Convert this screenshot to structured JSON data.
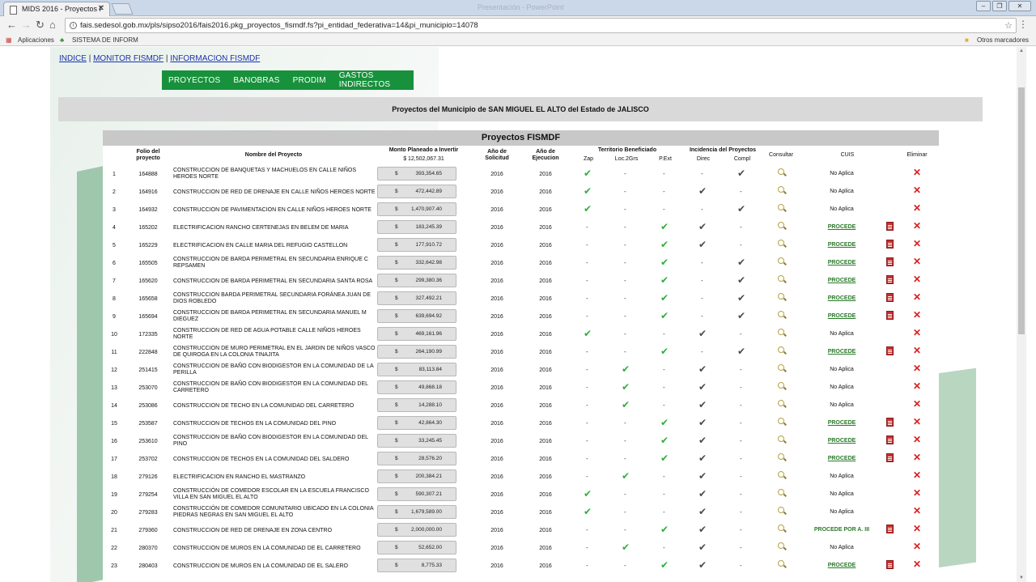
{
  "browser": {
    "tab_title": "MIDS 2016 - Proyectos F",
    "window_title": "Presentación - PowerPoint",
    "url": "fais.sedesol.gob.mx/pls/sipso2016/fais2016.pkg_proyectos_fismdf.fs?pi_entidad_federativa=14&pi_municipio=14078",
    "bookmarks": [
      "Aplicaciones",
      "SISTEMA DE INFORM"
    ],
    "other_bookmarks": "Otros marcadores"
  },
  "page": {
    "links": [
      "INDICE",
      "MONITOR FISMDF",
      "INFORMACION FISMDF"
    ],
    "separator": "|",
    "nav": [
      "PROYECTOS",
      "BANOBRAS",
      "PRODIM",
      "GASTOS INDIRECTOS"
    ],
    "header": "Proyectos del Municipio de SAN MIGUEL EL ALTO del Estado de JALISCO",
    "table_title": "Proyectos FISMDF",
    "columns": {
      "folio": "Folio del proyecto",
      "nombre": "Nombre del Proyecto",
      "monto": "Monto Planeado a Invertir",
      "monto_total": "$ 12,502,067.31",
      "anio_sol": "Año de Solicitud",
      "anio_eje": "Año de Ejecucion",
      "territorio": "Territorio Beneficiado",
      "zap": "Zap",
      "loc": "Loc.2Grs",
      "pext": "P.Ext",
      "incidencia": "Incidencia del Proyectos",
      "direc": "Direc",
      "compl": "Compl",
      "consultar": "Consultar",
      "cuis": "CUIS",
      "eliminar": "Eliminar"
    },
    "currency": "$",
    "dash": "-",
    "rows": [
      {
        "n": "1",
        "folio": "164888",
        "nombre": "CONSTRUCCION DE BANQUETAS Y MACHUELOS EN CALLE NIÑOS HEROES NORTE",
        "monto": "393,354.65",
        "sol": "2016",
        "eje": "2016",
        "zap": 1,
        "loc": 0,
        "pext": 0,
        "direc": 0,
        "compl": 1,
        "cuis": "No Aplica",
        "pdf": 0
      },
      {
        "n": "2",
        "folio": "164916",
        "nombre": "CONSTRUCCION DE RED DE DRENAJE EN CALLE NIÑOS HEROES NORTE",
        "monto": "472,442.89",
        "sol": "2016",
        "eje": "2016",
        "zap": 1,
        "loc": 0,
        "pext": 0,
        "direc": 1,
        "compl": 0,
        "cuis": "No Aplica",
        "pdf": 0
      },
      {
        "n": "3",
        "folio": "164932",
        "nombre": "CONSTRUCCION DE PAVIMENTACION EN CALLE NIÑOS HEROES NORTE",
        "monto": "1,470,907.40",
        "sol": "2016",
        "eje": "2016",
        "zap": 1,
        "loc": 0,
        "pext": 0,
        "direc": 0,
        "compl": 1,
        "cuis": "No Aplica",
        "pdf": 0
      },
      {
        "n": "4",
        "folio": "165202",
        "nombre": "ELECTRIFICACION RANCHO CERTENEJAS EN BELEM DE MARIA",
        "monto": "183,245.39",
        "sol": "2016",
        "eje": "2016",
        "zap": 0,
        "loc": 0,
        "pext": 1,
        "direc": 1,
        "compl": 0,
        "cuis": "PROCEDE",
        "pdf": 1
      },
      {
        "n": "5",
        "folio": "165229",
        "nombre": "ELECTRIFICACION EN CALLE MARIA DEL REFUGIO CASTELLON",
        "monto": "177,910.72",
        "sol": "2016",
        "eje": "2016",
        "zap": 0,
        "loc": 0,
        "pext": 1,
        "direc": 1,
        "compl": 0,
        "cuis": "PROCEDE",
        "pdf": 1
      },
      {
        "n": "6",
        "folio": "165505",
        "nombre": "CONSTRUCCION DE BARDA PERIMETRAL EN SECUNDARIA ENRIQUE C REPSAMEN",
        "monto": "332,642.98",
        "sol": "2016",
        "eje": "2016",
        "zap": 0,
        "loc": 0,
        "pext": 1,
        "direc": 0,
        "compl": 1,
        "cuis": "PROCEDE",
        "pdf": 1
      },
      {
        "n": "7",
        "folio": "165620",
        "nombre": "CONSTRUCCION DE BARDA PERIMETRAL EN SECUNDARIA SANTA ROSA",
        "monto": "299,380.36",
        "sol": "2016",
        "eje": "2016",
        "zap": 0,
        "loc": 0,
        "pext": 1,
        "direc": 0,
        "compl": 1,
        "cuis": "PROCEDE",
        "pdf": 1
      },
      {
        "n": "8",
        "folio": "165658",
        "nombre": "CONSTRUCCION BARDA PERIMETRAL SECUNDARIA FORÁNEA JUAN DE DIOS ROBLEDO",
        "monto": "327,492.21",
        "sol": "2016",
        "eje": "2016",
        "zap": 0,
        "loc": 0,
        "pext": 1,
        "direc": 0,
        "compl": 1,
        "cuis": "PROCEDE",
        "pdf": 1
      },
      {
        "n": "9",
        "folio": "165694",
        "nombre": "CONSTRUCCION DE BARDA PERIMETRAL EN SECUNDARIA MANUEL M DIEGUEZ",
        "monto": "639,694.92",
        "sol": "2016",
        "eje": "2016",
        "zap": 0,
        "loc": 0,
        "pext": 1,
        "direc": 0,
        "compl": 1,
        "cuis": "PROCEDE",
        "pdf": 1
      },
      {
        "n": "10",
        "folio": "172335",
        "nombre": "CONSTRUCCION DE RED DE AGUA POTABLE CALLE NIÑOS HEROES NORTE",
        "monto": "469,161.96",
        "sol": "2016",
        "eje": "2016",
        "zap": 1,
        "loc": 0,
        "pext": 0,
        "direc": 1,
        "compl": 0,
        "cuis": "No Aplica",
        "pdf": 0
      },
      {
        "n": "11",
        "folio": "222848",
        "nombre": "CONSTRUCCION DE MURO PERIMETRAL EN EL JARDIN DE NIÑOS VASCO DE QUIROGA EN LA COLONIA TINAJITA",
        "monto": "264,190.99",
        "sol": "2016",
        "eje": "2016",
        "zap": 0,
        "loc": 0,
        "pext": 1,
        "direc": 0,
        "compl": 1,
        "cuis": "PROCEDE",
        "pdf": 1
      },
      {
        "n": "12",
        "folio": "251415",
        "nombre": "CONSTRUCCION DE BAÑO CON BIODIGESTOR EN LA COMUNIDAD DE LA PERILLA",
        "monto": "83,113.84",
        "sol": "2016",
        "eje": "2016",
        "zap": 0,
        "loc": 1,
        "pext": 0,
        "direc": 1,
        "compl": 0,
        "cuis": "No Aplica",
        "pdf": 0
      },
      {
        "n": "13",
        "folio": "253070",
        "nombre": "CONSTRUCCION DE BAÑO CON BIODIGESTOR EN LA COMUNIDAD DEL CARRETERO",
        "monto": "49,868.18",
        "sol": "2016",
        "eje": "2016",
        "zap": 0,
        "loc": 1,
        "pext": 0,
        "direc": 1,
        "compl": 0,
        "cuis": "No Aplica",
        "pdf": 0
      },
      {
        "n": "14",
        "folio": "253086",
        "nombre": "CONSTRUCCION DE TECHO EN LA COMUNIDAD DEL CARRETERO",
        "monto": "14,288.10",
        "sol": "2016",
        "eje": "2016",
        "zap": 0,
        "loc": 1,
        "pext": 0,
        "direc": 1,
        "compl": 0,
        "cuis": "No Aplica",
        "pdf": 0
      },
      {
        "n": "15",
        "folio": "253587",
        "nombre": "CONSTRUCCION DE TECHOS EN LA COMUNIDAD DEL PINO",
        "monto": "42,864.30",
        "sol": "2016",
        "eje": "2016",
        "zap": 0,
        "loc": 0,
        "pext": 1,
        "direc": 1,
        "compl": 0,
        "cuis": "PROCEDE",
        "pdf": 1
      },
      {
        "n": "16",
        "folio": "253610",
        "nombre": "CONSTRUCCION DE BAÑO CON BIODIGESTOR EN LA COMUNIDAD DEL PINO",
        "monto": "33,245.45",
        "sol": "2016",
        "eje": "2016",
        "zap": 0,
        "loc": 0,
        "pext": 1,
        "direc": 1,
        "compl": 0,
        "cuis": "PROCEDE",
        "pdf": 1
      },
      {
        "n": "17",
        "folio": "253702",
        "nombre": "CONSTRUCCION DE TECHOS EN LA COMUNIDAD DEL SALDERO",
        "monto": "28,576.20",
        "sol": "2016",
        "eje": "2016",
        "zap": 0,
        "loc": 0,
        "pext": 1,
        "direc": 1,
        "compl": 0,
        "cuis": "PROCEDE",
        "pdf": 1
      },
      {
        "n": "18",
        "folio": "279126",
        "nombre": "ELECTRIFICACION EN RANCHO EL MASTRANZO",
        "monto": "200,384.21",
        "sol": "2016",
        "eje": "2016",
        "zap": 0,
        "loc": 1,
        "pext": 0,
        "direc": 1,
        "compl": 0,
        "cuis": "No Aplica",
        "pdf": 0
      },
      {
        "n": "19",
        "folio": "279254",
        "nombre": "CONSTRUCCIÓN DE COMEDOR ESCOLAR EN LA ESCUELA FRANCISCO VILLA EN SAN MIGUEL EL ALTO",
        "monto": "590,307.21",
        "sol": "2016",
        "eje": "2016",
        "zap": 1,
        "loc": 0,
        "pext": 0,
        "direc": 1,
        "compl": 0,
        "cuis": "No Aplica",
        "pdf": 0
      },
      {
        "n": "20",
        "folio": "279283",
        "nombre": "CONSTRUCCIÓN DE COMEDOR COMUNITARIO UBICADO EN LA COLONIA PIEDRAS NEGRAS EN SAN MIGUEL EL ALTO",
        "monto": "1,679,589.00",
        "sol": "2016",
        "eje": "2016",
        "zap": 1,
        "loc": 0,
        "pext": 0,
        "direc": 1,
        "compl": 0,
        "cuis": "No Aplica",
        "pdf": 0
      },
      {
        "n": "21",
        "folio": "279360",
        "nombre": "CONSTRUCCION DE RED DE DRENAJE EN ZONA CENTRO",
        "monto": "2,000,000.00",
        "sol": "2016",
        "eje": "2016",
        "zap": 0,
        "loc": 0,
        "pext": 1,
        "direc": 1,
        "compl": 0,
        "cuis": "PROCEDE POR A. III",
        "pdf": 1
      },
      {
        "n": "22",
        "folio": "280370",
        "nombre": "CONSTRUCCION DE MUROS EN LA COMUNIDAD DE EL CARRETERO",
        "monto": "52,652.00",
        "sol": "2016",
        "eje": "2016",
        "zap": 0,
        "loc": 1,
        "pext": 0,
        "direc": 1,
        "compl": 0,
        "cuis": "No Aplica",
        "pdf": 0
      },
      {
        "n": "23",
        "folio": "280403",
        "nombre": "CONSTRUCCION DE MUROS EN LA COMUNIDAD DE EL SALERO",
        "monto": "8,775.33",
        "sol": "2016",
        "eje": "2016",
        "zap": 0,
        "loc": 0,
        "pext": 1,
        "direc": 1,
        "compl": 0,
        "cuis": "PROCEDE",
        "pdf": 1
      }
    ]
  },
  "colors": {
    "nav_green": "#18913c",
    "check_green": "#2fae3a",
    "delete_red": "#d92020"
  }
}
